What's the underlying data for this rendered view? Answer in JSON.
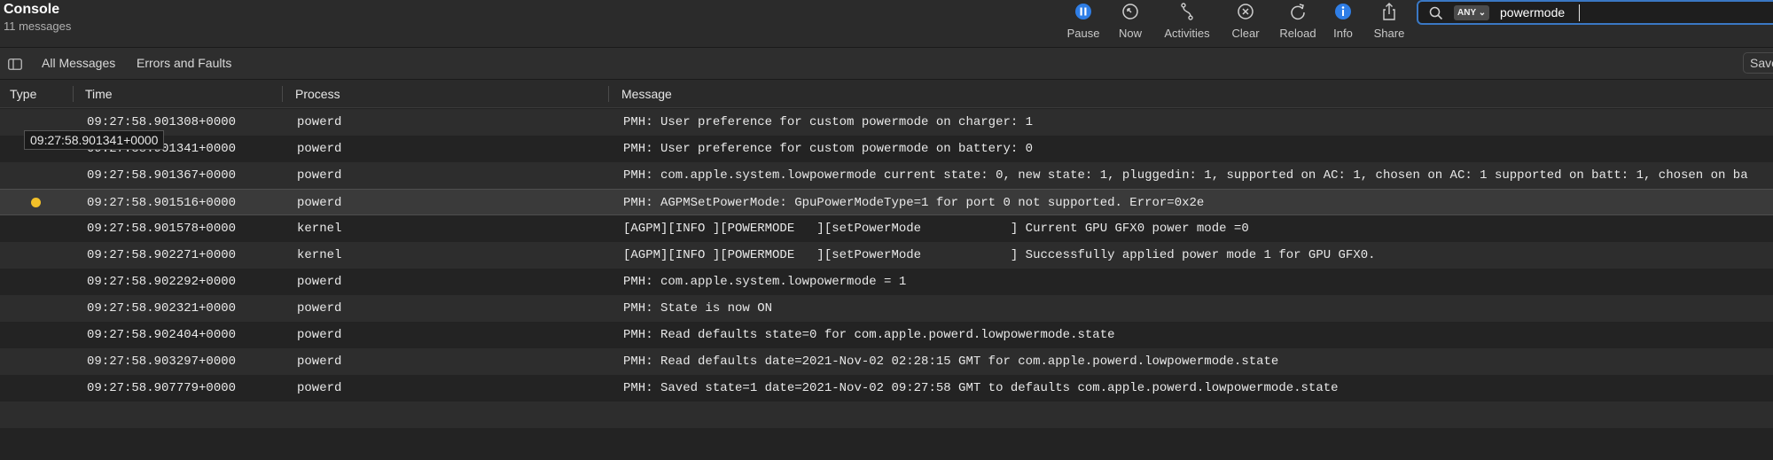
{
  "app": {
    "title": "Console",
    "subtitle": "11 messages"
  },
  "toolbar": {
    "pause": "Pause",
    "now": "Now",
    "activities": "Activities",
    "clear": "Clear",
    "reload": "Reload",
    "info": "Info",
    "share": "Share"
  },
  "search": {
    "scope": "ANY",
    "term": "powermode"
  },
  "filters": {
    "all_messages": "All Messages",
    "errors_and_faults": "Errors and Faults",
    "save": "Save"
  },
  "columns": {
    "type": "Type",
    "time": "Time",
    "process": "Process",
    "message": "Message"
  },
  "tooltip": "09:27:58.901341+0000",
  "rows": [
    {
      "time": "09:27:58.901308+0000",
      "process": "powerd",
      "message": "PMH: User preference for custom powermode on charger: 1"
    },
    {
      "time": "09:27:58.901341+0000",
      "process": "powerd",
      "message": "PMH: User preference for custom powermode on battery: 0"
    },
    {
      "time": "09:27:58.901367+0000",
      "process": "powerd",
      "message": "PMH: com.apple.system.lowpowermode current state: 0, new state: 1, pluggedin: 1, supported on AC: 1, chosen on AC: 1 supported on batt: 1, chosen on ba"
    },
    {
      "time": "09:27:58.901516+0000",
      "process": "powerd",
      "message": "PMH: AGPMSetPowerMode: GpuPowerModeType=1 for port 0 not supported. Error=0x2e"
    },
    {
      "time": "09:27:58.901578+0000",
      "process": "kernel",
      "message": "[AGPM][INFO ][POWERMODE   ][setPowerMode            ] Current GPU GFX0 power mode =0"
    },
    {
      "time": "09:27:58.902271+0000",
      "process": "kernel",
      "message": "[AGPM][INFO ][POWERMODE   ][setPowerMode            ] Successfully applied power mode 1 for GPU GFX0."
    },
    {
      "time": "09:27:58.902292+0000",
      "process": "powerd",
      "message": "PMH: com.apple.system.lowpowermode = 1"
    },
    {
      "time": "09:27:58.902321+0000",
      "process": "powerd",
      "message": "PMH: State is now ON"
    },
    {
      "time": "09:27:58.902404+0000",
      "process": "powerd",
      "message": "PMH: Read defaults state=0 for com.apple.powerd.lowpowermode.state"
    },
    {
      "time": "09:27:58.903297+0000",
      "process": "powerd",
      "message": "PMH: Read defaults date=2021-Nov-02 02:28:15 GMT for com.apple.powerd.lowpowermode.state"
    },
    {
      "time": "09:27:58.907779+0000",
      "process": "powerd",
      "message": "PMH: Saved state=1 date=2021-Nov-02 09:27:58 GMT to defaults com.apple.powerd.lowpowermode.state"
    }
  ],
  "colors": {
    "accent": "#3a78c4",
    "error_dot": "#f2c029"
  }
}
